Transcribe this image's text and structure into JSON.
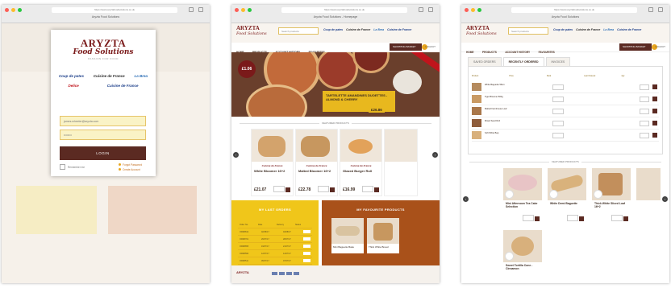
{
  "colors": {
    "brand_maroon": "#7a1a1a",
    "button_brown": "#5b2a22",
    "accent_yellow": "#f0c61a",
    "accent_orange": "#a9511a"
  },
  "window1": {
    "url": "https://www.aryztafoodsolutions.co.uk",
    "tab_title": "Aryzta Food Solutions",
    "logo_main": "ARYZTA",
    "logo_sub": "Food Solutions",
    "logo_tag": "PASSION FOR FOOD",
    "brands": [
      "Coup de pates",
      "Cuisine de France",
      "La Brea",
      "Delice",
      "Cuisine de France"
    ],
    "email_value": "james.wheeler@aryzta.com",
    "password_value": "••••••••",
    "login_label": "LOGIN",
    "remember_label": "Remember me",
    "forgot_label": "Forgot Password",
    "create_label": "Create Account"
  },
  "window2": {
    "url": "https://www.aryztafoodsolutions.co.uk",
    "tab_title": "Aryzta Food Solutions - Homepage",
    "logo_main": "ARYZTA",
    "logo_sub": "Food Solutions",
    "search_placeholder": "Search products",
    "nav": [
      "HOME",
      "PRODUCTS",
      "ACCOUNT HISTORY",
      "FAVOURITES"
    ],
    "basket_label": "SHOPPING BASKET",
    "signout_label": "LOGOUT",
    "hero_price": "£1.06",
    "hero_caption": "TARTELETTE AMANDINES DUOETTES - ALMOND & CHERRY",
    "hero_case_price": "£26.86",
    "featured_title": "FEATURED PRODUCTS",
    "products": [
      {
        "name": "White Bloomer 16+2",
        "price": "£21.07"
      },
      {
        "name": "Malted Bloomer 16+2",
        "price": "£22.78"
      },
      {
        "name": "Glazed Burger Roll",
        "price": "£16.99"
      }
    ],
    "last_orders_title": "MY LAST ORDERS",
    "orders_header": [
      "Order No",
      "Date",
      "Delivery",
      "Status"
    ],
    "orders_rows": [
      [
        "ORD8812",
        "02/08/17",
        "04/08/17"
      ],
      [
        "ORD8701",
        "26/07/17",
        "28/07/17"
      ],
      [
        "ORD8655",
        "19/07/17",
        "21/07/17"
      ],
      [
        "ORD8590",
        "12/07/17",
        "14/07/17"
      ],
      [
        "ORD8511",
        "05/07/17",
        "07/07/17"
      ]
    ],
    "view_all_label": "VIEW ALL",
    "favourites_title": "MY FAVOURITE PRODUCTS",
    "favourites": [
      "Mini Baguette Bake",
      "Thick White Bread"
    ]
  },
  "window3": {
    "url": "https://www.aryztafoodsolutions.co.uk",
    "tab_title": "Aryzta Food Solutions",
    "tabs": [
      "SAVED ORDERS",
      "RECENTLY ORDERED",
      "INVOICES"
    ],
    "table_header": [
      "",
      "Product",
      "Price",
      "Pack",
      "Last Ordered",
      "Qty",
      ""
    ],
    "rows": [
      "White Baguette 56cm",
      "Tiger Bloomer 800g",
      "Malted Farmhouse Loaf",
      "Mixed Seed Roll",
      "Soft White Bap"
    ],
    "related_title": "FEATURED PRODUCTS",
    "related": [
      {
        "name": "Mini Afternoon Tea Cake Selection"
      },
      {
        "name": "White Demi Baguette"
      },
      {
        "name": "Thick White Sliced Loaf 16+2"
      },
      {
        "name": "Sweet Tortilla Cone - Cinnamon"
      }
    ]
  }
}
